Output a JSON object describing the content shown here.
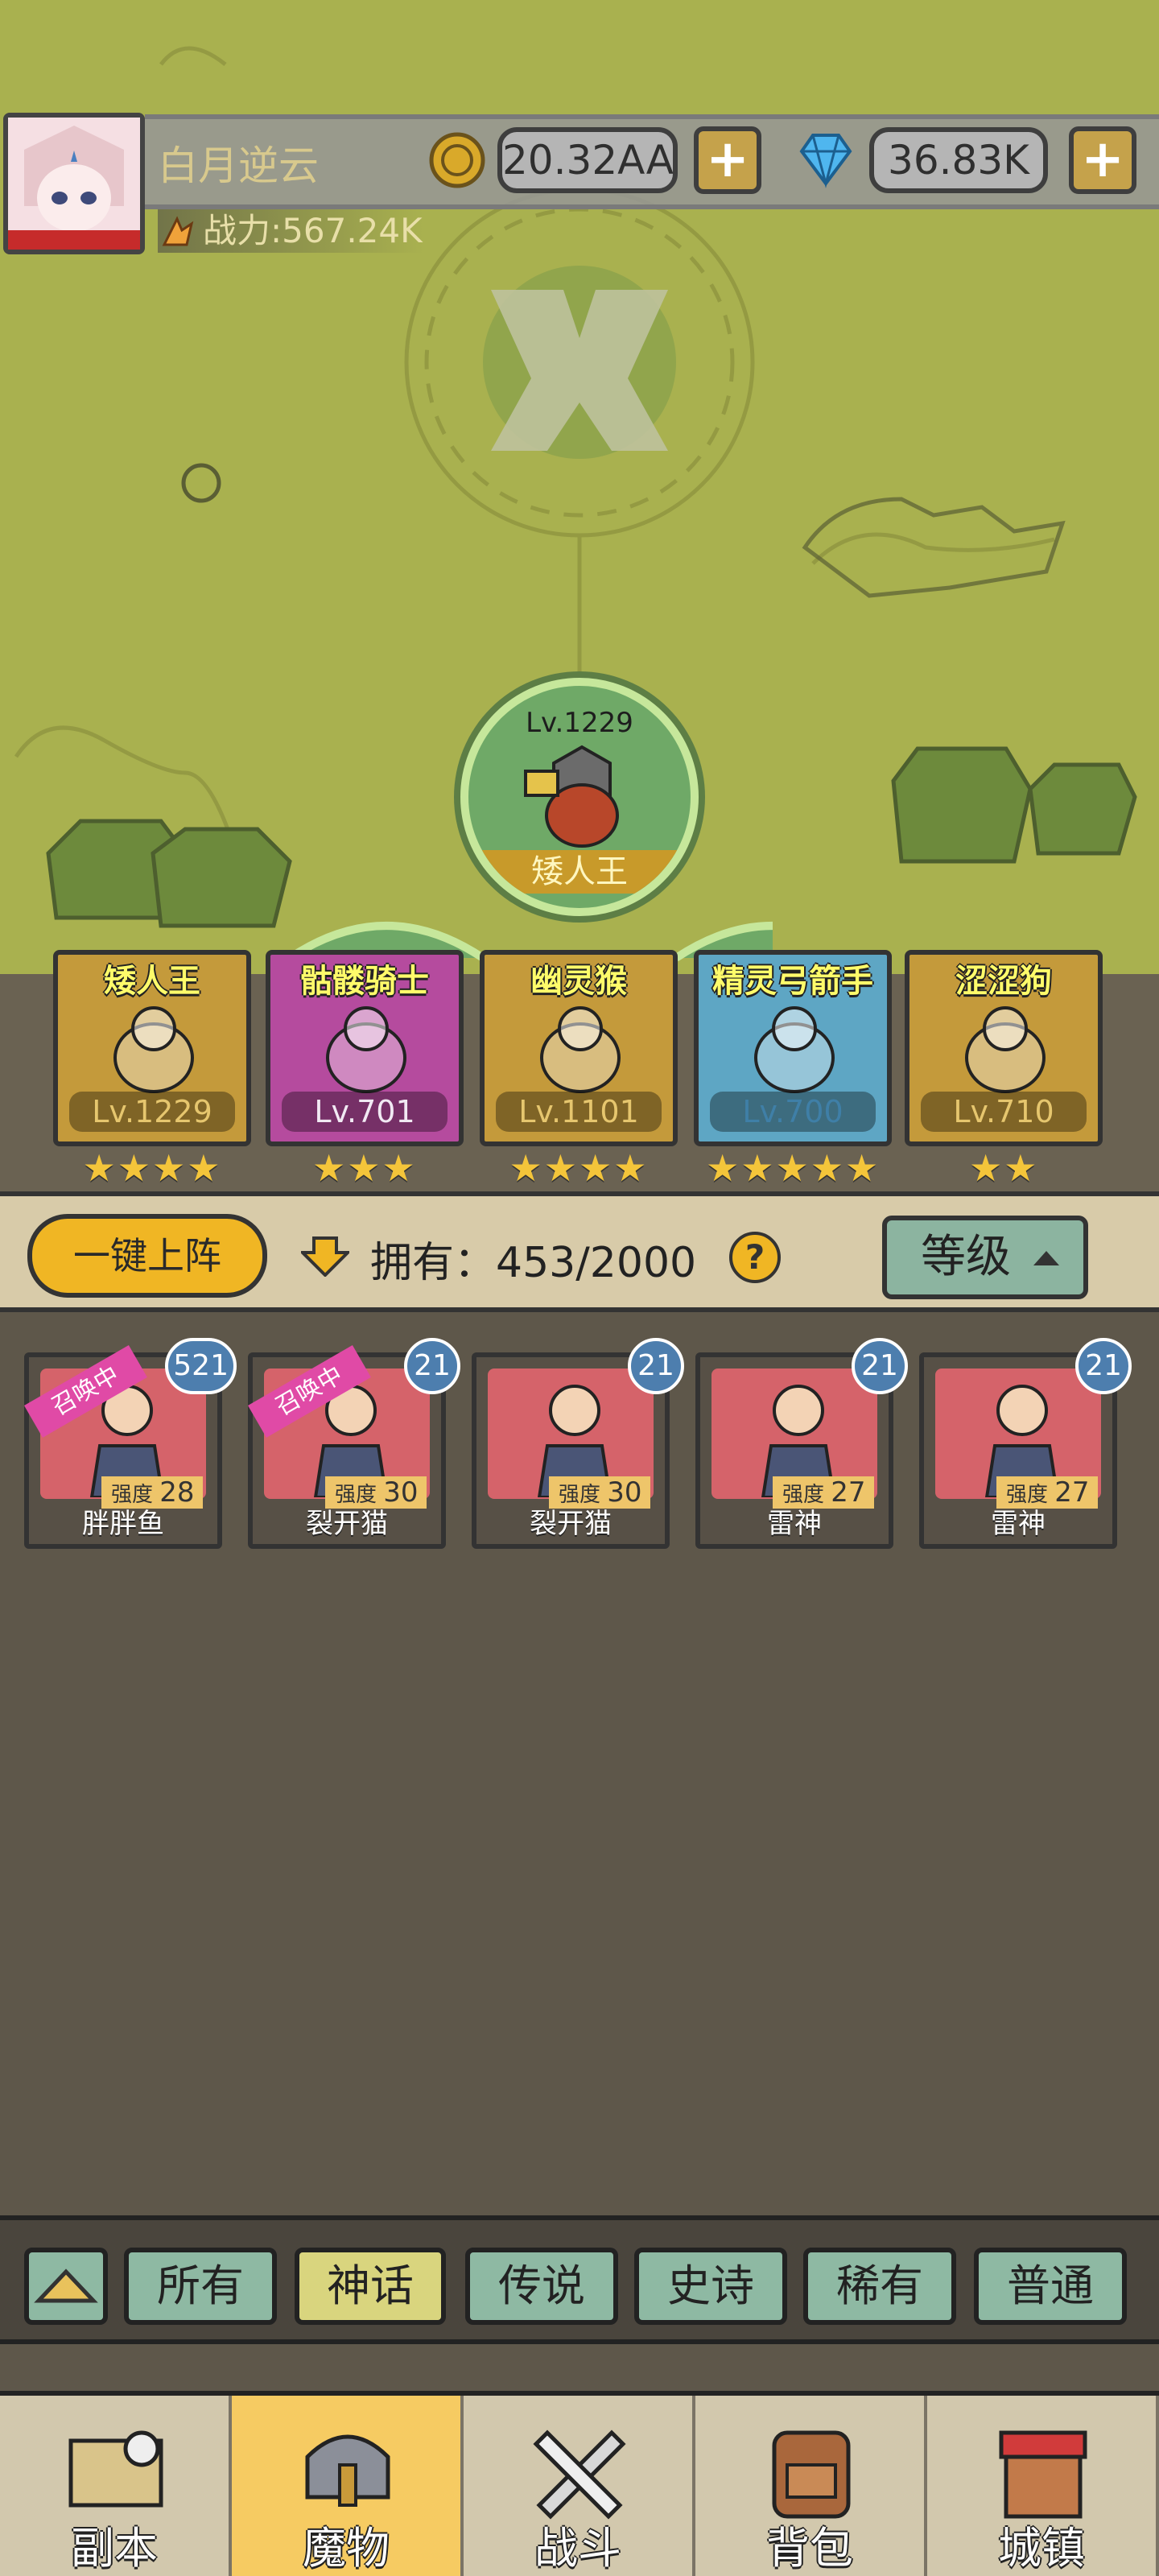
{
  "header": {
    "username": "白月逆云",
    "gold": "20.32AA",
    "gems": "36.83K",
    "power": "战力:567.24K"
  },
  "boss": {
    "level": "Lv.1229",
    "name": "矮人王"
  },
  "team": [
    {
      "name": "矮人王",
      "level": "Lv.1229",
      "stars": 4,
      "star_text": "★★★★",
      "color": "#c49a3b",
      "lvcolor": "#e6c66e"
    },
    {
      "name": "骷髅骑士",
      "level": "Lv.701",
      "stars": 3,
      "star_text": "★★★",
      "color": "#b54b9e",
      "lvcolor": "#f1e9f3"
    },
    {
      "name": "幽灵猴",
      "level": "Lv.1101",
      "stars": 4,
      "star_text": "★★★★",
      "color": "#c49a3b",
      "lvcolor": "#e6c66e"
    },
    {
      "name": "精灵弓箭手",
      "level": "Lv.700",
      "stars": 5,
      "star_text": "★★★★★",
      "color": "#5ea6c4",
      "lvcolor": "#3f7fa7"
    },
    {
      "name": "涩涩狗",
      "level": "Lv.710",
      "stars": 2,
      "star_text": "★★",
      "color": "#c49a3b",
      "lvcolor": "#e6c66e"
    }
  ],
  "toolbar": {
    "auto_deploy": "一键上阵",
    "own_label": "拥有：",
    "own_count": "453/2000",
    "help": "?",
    "sort_label": "等级"
  },
  "monsters": [
    {
      "name": "胖胖鱼",
      "power_label": "强度",
      "power": "28",
      "count": "521",
      "ribbon": "召唤中"
    },
    {
      "name": "裂开猫",
      "power_label": "强度",
      "power": "30",
      "count": "21",
      "ribbon": "召唤中"
    },
    {
      "name": "裂开猫",
      "power_label": "强度",
      "power": "30",
      "count": "21",
      "ribbon": ""
    },
    {
      "name": "雷神",
      "power_label": "强度",
      "power": "27",
      "count": "21",
      "ribbon": ""
    },
    {
      "name": "雷神",
      "power_label": "强度",
      "power": "27",
      "count": "21",
      "ribbon": ""
    }
  ],
  "filters": [
    "所有",
    "神话",
    "传说",
    "史诗",
    "稀有",
    "普通"
  ],
  "active_filter": "神话",
  "nav": [
    {
      "label": "副本",
      "icon": "map-icon"
    },
    {
      "label": "魔物",
      "icon": "helmet-icon"
    },
    {
      "label": "战斗",
      "icon": "swords-icon"
    },
    {
      "label": "背包",
      "icon": "backpack-icon"
    },
    {
      "label": "城镇",
      "icon": "shop-icon"
    }
  ],
  "active_nav": "魔物"
}
